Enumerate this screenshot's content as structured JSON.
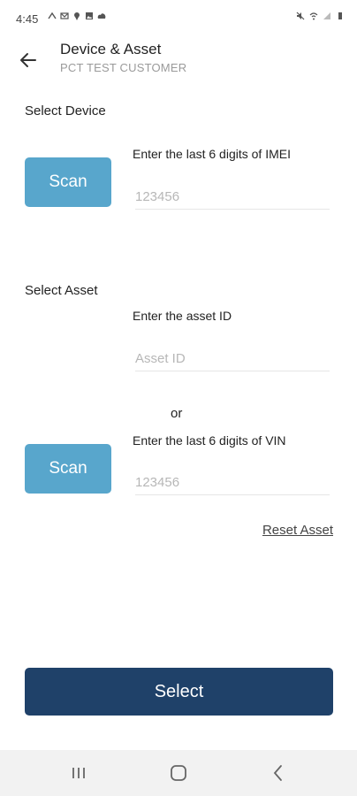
{
  "status_bar": {
    "time": "4:45",
    "left_icons": [
      "signal-cast-icon",
      "gmail-icon",
      "location-icon",
      "image-icon",
      "cloud-icon"
    ],
    "right_icons": [
      "mute-icon",
      "wifi-icon",
      "signal-icon",
      "battery-icon"
    ]
  },
  "header": {
    "title": "Device & Asset",
    "subtitle": "PCT TEST CUSTOMER"
  },
  "device_section": {
    "label": "Select Device",
    "scan_label": "Scan",
    "field_label": "Enter the last 6 digits of IMEI",
    "placeholder": "123456"
  },
  "asset_section": {
    "label": "Select Asset",
    "asset_id_label": "Enter the asset ID",
    "asset_id_placeholder": "Asset ID",
    "or_text": "or",
    "vin_label": "Enter the last 6 digits of VIN",
    "vin_placeholder": "123456",
    "scan_label": "Scan",
    "reset_label": "Reset Asset"
  },
  "footer": {
    "select_label": "Select"
  },
  "colors": {
    "scan_button": "#58a6cc",
    "select_button": "#1f4169"
  }
}
